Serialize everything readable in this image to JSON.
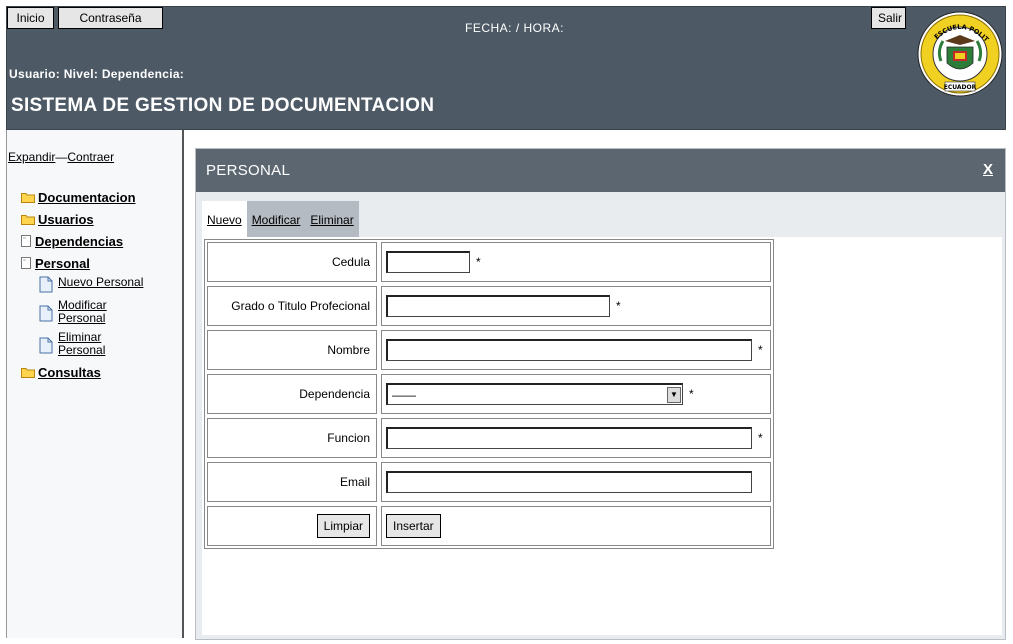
{
  "header": {
    "btn_inicio": "Inicio",
    "btn_contrasena": "Contraseña",
    "btn_salir": "Salir",
    "fecha_hora": "FECHA:  /  HORA:",
    "user_line": "Usuario:   Nivel:   Dependencia:",
    "system_title": "SISTEMA DE GESTION DE DOCUMENTACION",
    "seal_top": "ESCUELA POLITECNICA DEL EJERCITO",
    "seal_bottom": "ECUADOR",
    "colors": {
      "bar": "#4d5a66",
      "panel_head": "#5b6670"
    }
  },
  "sidebar": {
    "expandir": "Expandir",
    "sep": "—",
    "contraer": "Contraer",
    "nodes": {
      "documentacion": "Documentacion",
      "usuarios": "Usuarios",
      "dependencias": "Dependencias",
      "personal": "Personal",
      "consultas": "Consultas"
    },
    "subitems": {
      "nuevo": "Nuevo Personal",
      "modificar_1": "Modificar",
      "modificar_2": "Personal",
      "eliminar_1": "Eliminar",
      "eliminar_2": "Personal"
    }
  },
  "panel": {
    "title": "PERSONAL",
    "close": "X",
    "tabs": {
      "nuevo": "Nuevo",
      "modificar": "Modificar",
      "eliminar": "Eliminar"
    }
  },
  "form": {
    "labels": {
      "cedula": "Cedula",
      "grado": "Grado o Titulo Profecional",
      "nombre": "Nombre",
      "dependencia": "Dependencia",
      "funcion": "Funcion",
      "email": "Email"
    },
    "values": {
      "cedula": "",
      "grado": "",
      "nombre": "",
      "funcion": "",
      "email": ""
    },
    "dependencia_selected": "——",
    "required_mark": "*",
    "buttons": {
      "limpiar": "Limpiar",
      "insertar": "Insertar"
    }
  }
}
